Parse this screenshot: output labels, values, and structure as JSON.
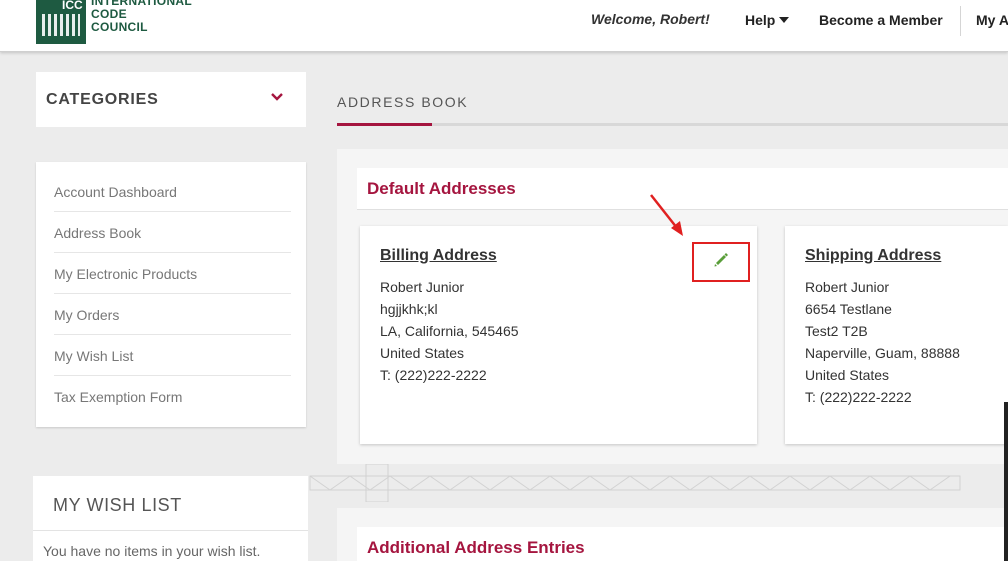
{
  "brand": {
    "mark": "ICC",
    "name_lines": [
      "INTERNATIONAL",
      "CODE",
      "COUNCIL"
    ],
    "color": "#1e5a41"
  },
  "header": {
    "welcome": "Welcome, Robert!",
    "help": "Help",
    "become_member": "Become a Member",
    "my_account": "My A"
  },
  "sidebar": {
    "categories_title": "CATEGORIES",
    "menu": [
      {
        "label": "Account Dashboard"
      },
      {
        "label": "Address Book"
      },
      {
        "label": "My Electronic Products"
      },
      {
        "label": "My Orders"
      },
      {
        "label": "My Wish List"
      },
      {
        "label": "Tax Exemption Form"
      }
    ],
    "wishlist_title": "MY WISH LIST",
    "wishlist_empty": "You have no items in your wish list."
  },
  "main": {
    "page_title": "ADDRESS BOOK",
    "default_title": "Default Addresses",
    "billing": {
      "title": "Billing Address",
      "lines": [
        "Robert Junior",
        "hgjjkhk;kl",
        "LA, California, 545465",
        "United States",
        "T: (222)222-2222"
      ]
    },
    "shipping": {
      "title": "Shipping Address",
      "lines": [
        "Robert Junior",
        "6654 Testlane",
        "Test2 T2B",
        "Naperville, Guam, 88888",
        "United States",
        "T: (222)222-2222"
      ]
    },
    "additional_title": "Additional Address Entries"
  },
  "colors": {
    "accent": "#a5153f",
    "highlight": "#e02020",
    "edit_icon": "#5a9e3a"
  },
  "icons": [
    "chevron-down-icon",
    "pencil-icon",
    "caret-down-icon",
    "arrow-pointer-icon"
  ]
}
